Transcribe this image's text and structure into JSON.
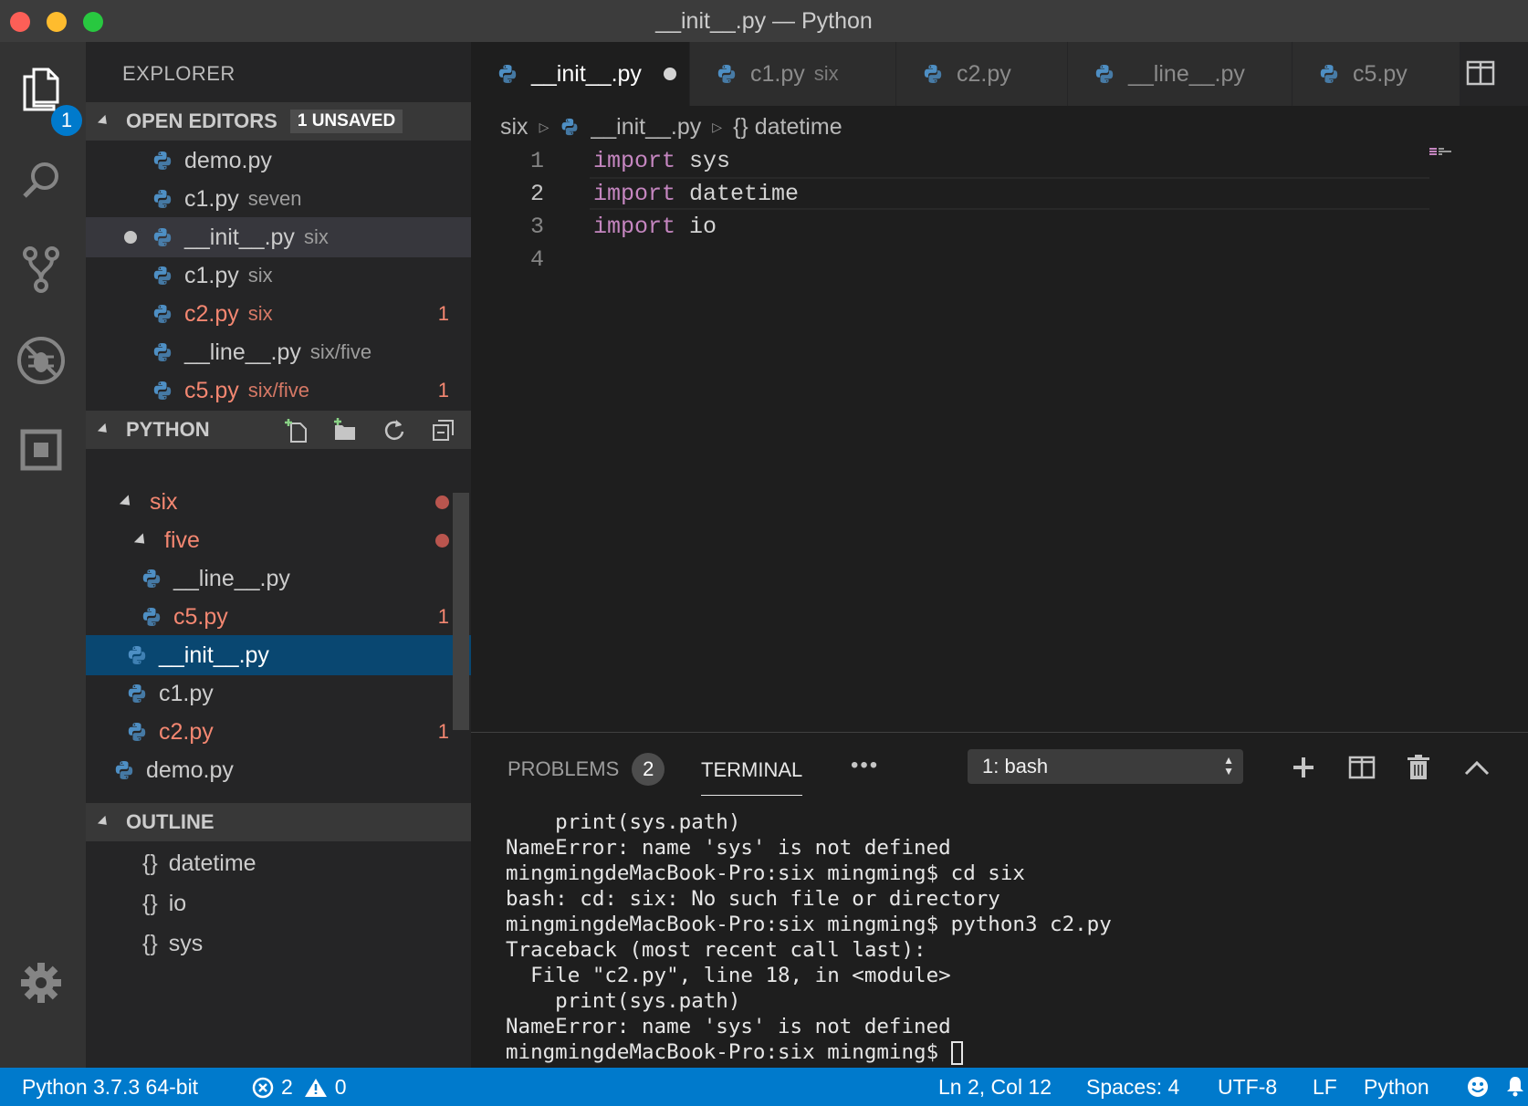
{
  "window": {
    "title": "__init__.py — Python"
  },
  "activity": {
    "explorer_badge": "1"
  },
  "sidebar": {
    "title": "EXPLORER",
    "open_editors": {
      "label": "OPEN EDITORS",
      "unsaved": "1 UNSAVED",
      "items": [
        {
          "name": "demo.py",
          "desc": ""
        },
        {
          "name": "c1.py",
          "desc": "seven"
        },
        {
          "name": "__init__.py",
          "desc": "six"
        },
        {
          "name": "c1.py",
          "desc": "six"
        },
        {
          "name": "c2.py",
          "desc": "six",
          "count": "1"
        },
        {
          "name": "__line__.py",
          "desc": "six/five"
        },
        {
          "name": "c5.py",
          "desc": "six/five",
          "count": "1"
        }
      ]
    },
    "python": {
      "label": "PYTHON",
      "tree": [
        {
          "name": "six"
        },
        {
          "name": "five"
        },
        {
          "name": "__line__.py"
        },
        {
          "name": "c5.py",
          "count": "1"
        },
        {
          "name": "__init__.py"
        },
        {
          "name": "c1.py"
        },
        {
          "name": "c2.py",
          "count": "1"
        },
        {
          "name": "demo.py"
        }
      ]
    },
    "outline": {
      "label": "OUTLINE",
      "items": [
        {
          "icon": "{}",
          "name": "datetime"
        },
        {
          "icon": "{}",
          "name": "io"
        },
        {
          "icon": "{}",
          "name": "sys"
        }
      ]
    }
  },
  "tabs": [
    {
      "name": "__init__.py",
      "desc": ""
    },
    {
      "name": "c1.py",
      "desc": "six"
    },
    {
      "name": "c2.py",
      "desc": ""
    },
    {
      "name": "__line__.py",
      "desc": ""
    },
    {
      "name": "c5.py",
      "desc": ""
    }
  ],
  "breadcrumb": {
    "folder": "six",
    "file": "__init__.py",
    "symbol": "{} datetime"
  },
  "editor": {
    "lines": [
      {
        "n": "1",
        "kw": "import",
        "rest": " sys"
      },
      {
        "n": "2",
        "kw": "import",
        "rest": " datetime"
      },
      {
        "n": "3",
        "kw": "import",
        "rest": " io"
      },
      {
        "n": "4",
        "kw": "",
        "rest": ""
      }
    ]
  },
  "panel": {
    "problems_label": "PROBLEMS",
    "problems_count": "2",
    "terminal_label": "TERMINAL",
    "more": "•••",
    "terminal_select": "1: bash",
    "terminal_lines": [
      "    print(sys.path)",
      "NameError: name 'sys' is not defined",
      "mingmingdeMacBook-Pro:six mingming$ cd six",
      "bash: cd: six: No such file or directory",
      "mingmingdeMacBook-Pro:six mingming$ python3 c2.py",
      "Traceback (most recent call last):",
      "  File \"c2.py\", line 18, in <module>",
      "    print(sys.path)",
      "NameError: name 'sys' is not defined",
      "mingmingdeMacBook-Pro:six mingming$ "
    ]
  },
  "status": {
    "interpreter": "Python 3.7.3 64-bit",
    "errors": "2",
    "warnings": "0",
    "position": "Ln 2, Col 12",
    "spaces": "Spaces: 4",
    "encoding": "UTF-8",
    "eol": "LF",
    "language": "Python"
  },
  "colors": {
    "accent": "#007acc",
    "error": "#f48771",
    "keyword": "#c586c0",
    "selection": "#094771"
  }
}
